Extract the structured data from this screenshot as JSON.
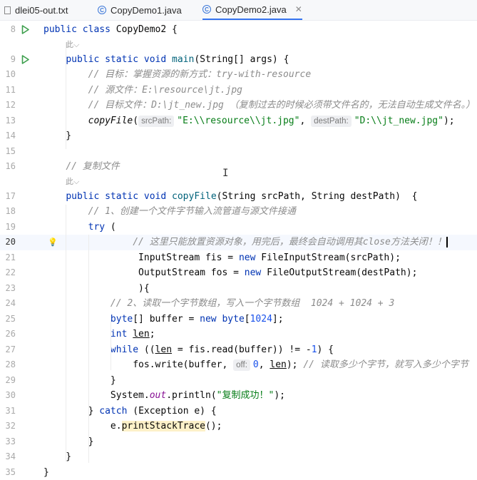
{
  "tabs": [
    {
      "label": "dlei05-out.txt"
    },
    {
      "label": "CopyDemo1.java"
    },
    {
      "label": "CopyDemo2.java",
      "active": true
    }
  ],
  "lens_label": "此⌵",
  "lines": [
    {
      "n": 8,
      "run": true,
      "html": "<span class='kw'>public class</span> CopyDemo2 {"
    },
    {
      "n": 9,
      "run": true,
      "html": "    <span class='kw'>public static void</span> <span class='fn'>main</span>(String[] args) {"
    },
    {
      "n": 10,
      "html": "        <span class='cm'>// 目标：掌握资源的新方式：try-with-resource</span>"
    },
    {
      "n": 11,
      "html": "        <span class='cm'>// 源文件：E:\\resource\\jt.jpg</span>"
    },
    {
      "n": 12,
      "html": "        <span class='cm'>// 目标文件：D:\\jt_new.jpg （复制过去的时候必须带文件名的，无法自动生成文件名。）</span>"
    },
    {
      "n": 13,
      "html": "        <span class='it'>copyFile</span>(<span class='hint'>srcPath:</span><span class='st'>\"E:\\\\resource\\\\jt.jpg\"</span>, <span class='hint'>destPath:</span><span class='st'>\"D:\\\\jt_new.jpg\"</span>);"
    },
    {
      "n": 14,
      "html": "    }"
    },
    {
      "n": 15,
      "html": ""
    },
    {
      "n": 16,
      "html": "    <span class='cm'>// 复制文件</span>"
    },
    {
      "n": 17,
      "html": "    <span class='kw'>public static void</span> <span class='fn'>copyFile</span>(String srcPath, String destPath)  {"
    },
    {
      "n": 18,
      "html": "        <span class='cm'>// 1、创建一个文件字节输入流管道与源文件接通</span>"
    },
    {
      "n": 19,
      "html": "        <span class='kw'>try</span> ("
    },
    {
      "n": 20,
      "caret": true,
      "bulb": true,
      "html": "                <span class='cm'>// 这里只能放置资源对象，用完后，最终会自动调用其close方法关闭！！</span><span class='textcaret'></span>"
    },
    {
      "n": 21,
      "html": "                 InputStream fis = <span class='kw'>new</span> FileInputStream(srcPath);"
    },
    {
      "n": 22,
      "html": "                 OutputStream fos = <span class='kw'>new</span> FileOutputStream(destPath);"
    },
    {
      "n": 23,
      "html": "                 ){"
    },
    {
      "n": 24,
      "html": "            <span class='cm'>// 2、读取一个字节数组，写入一个字节数组  1024 + 1024 + 3</span>"
    },
    {
      "n": 25,
      "html": "            <span class='kw'>byte</span>[] buffer = <span class='kw'>new byte</span>[<span class='num'>1024</span>];"
    },
    {
      "n": 26,
      "html": "            <span class='kw'>int</span> <u>len</u>;"
    },
    {
      "n": 27,
      "html": "            <span class='kw'>while</span> ((<u>len</u> = fis.read(buffer)) != -<span class='num'>1</span>) {"
    },
    {
      "n": 28,
      "html": "                fos.write(buffer, <span class='hint'>off:</span><span class='num'>0</span>, <u>len</u>); <span class='cm'>// 读取多少个字节，就写入多少个字节</span>"
    },
    {
      "n": 29,
      "html": "            }"
    },
    {
      "n": 30,
      "html": "            System.<span class='sf'>out</span>.println(<span class='st'>\"复制成功！\"</span>);"
    },
    {
      "n": 31,
      "html": "        } <span class='kw'>catch</span> (Exception e) {"
    },
    {
      "n": 32,
      "html": "            e.<span class='hl-warn'>printStackTrace</span>();"
    },
    {
      "n": 33,
      "html": "        }"
    },
    {
      "n": 34,
      "html": "    }"
    },
    {
      "n": 35,
      "html": "}"
    }
  ],
  "colors": {
    "accent": "#3574f0",
    "keyword": "#0033b3",
    "string": "#067d17",
    "comment": "#8c8c8c"
  }
}
